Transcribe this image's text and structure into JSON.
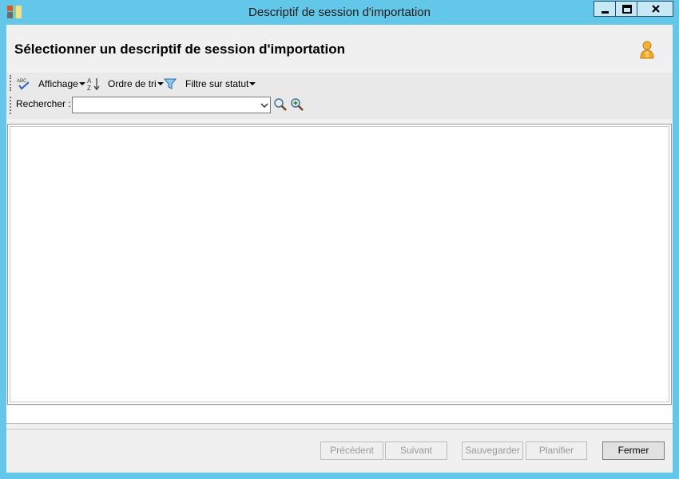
{
  "window": {
    "title": "Descriptif de session d'importation",
    "controls": {
      "minimize_icon": "minimize-icon",
      "maximize_icon": "maximize-icon",
      "close_icon": "close-icon"
    }
  },
  "header": {
    "title": "Sélectionner un descriptif de session d'importation",
    "user_icon": "person-icon"
  },
  "toolbar": {
    "spellcheck_icon": "abc-check-icon",
    "view_label": "Affichage",
    "sort_icon": "sort-az-icon",
    "sort_label": "Ordre de tri",
    "filter_icon": "funnel-icon",
    "status_filter_label": "Filtre sur statut"
  },
  "search": {
    "label": "Rechercher :",
    "value": "",
    "search_icon": "magnifier-icon",
    "advanced_icon": "zoom-plus-icon"
  },
  "list": {
    "items": []
  },
  "footer": {
    "previous": "Précédent",
    "next": "Suivant",
    "save": "Sauvegarder",
    "schedule": "Planifier",
    "close": "Fermer"
  },
  "colors": {
    "frame": "#63c7ea",
    "client": "#f0f0f0",
    "close_button": "#c7e9f6"
  }
}
